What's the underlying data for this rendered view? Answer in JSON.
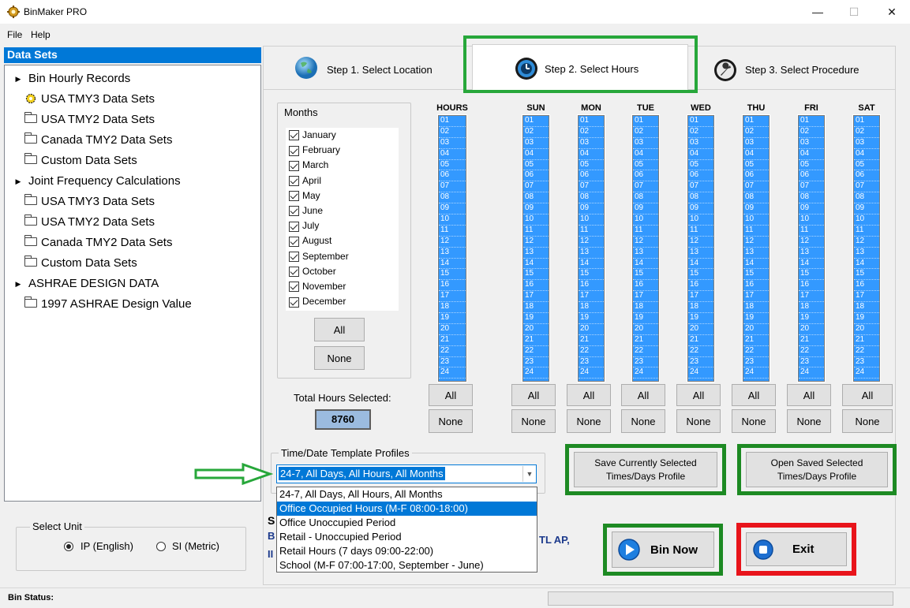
{
  "window": {
    "title": "BinMaker PRO",
    "minimize": "—",
    "maximize": "☐",
    "close": "✕"
  },
  "menu": {
    "file": "File",
    "help": "Help"
  },
  "data_sets": {
    "header": "Data Sets",
    "items": [
      {
        "label": "Bin Hourly Records",
        "icon": "expand-triangle"
      },
      {
        "label": "USA TMY3 Data Sets",
        "icon": "gear-icon"
      },
      {
        "label": "USA TMY2 Data Sets",
        "icon": "folder-icon"
      },
      {
        "label": "Canada TMY2 Data Sets",
        "icon": "folder-icon"
      },
      {
        "label": "Custom Data Sets",
        "icon": "folder-icon"
      },
      {
        "label": "Joint Frequency Calculations",
        "icon": "expand-triangle"
      },
      {
        "label": "USA TMY3 Data Sets",
        "icon": "folder-icon"
      },
      {
        "label": "USA TMY2 Data Sets",
        "icon": "folder-icon"
      },
      {
        "label": "Canada TMY2 Data Sets",
        "icon": "folder-icon"
      },
      {
        "label": "Custom Data Sets",
        "icon": "folder-icon"
      },
      {
        "label": "ASHRAE DESIGN DATA",
        "icon": "expand-triangle"
      },
      {
        "label": "1997 ASHRAE Design Value",
        "icon": "folder-icon"
      }
    ]
  },
  "unit": {
    "legend": "Select Unit",
    "ip": "IP (English)",
    "si": "SI (Metric)",
    "selected": "ip"
  },
  "tabs": {
    "step1": "Step 1.  Select Location",
    "step2": "Step 2.  Select Hours",
    "step3": "Step 3.  Select Procedure",
    "active": "step2"
  },
  "months": {
    "legend": "Months",
    "items": [
      "January",
      "February",
      "March",
      "April",
      "May",
      "June",
      "July",
      "August",
      "September",
      "October",
      "November",
      "December"
    ],
    "all_label": "All",
    "none_label": "None"
  },
  "hours": {
    "columns": [
      "HOURS",
      "SUN",
      "MON",
      "TUE",
      "WED",
      "THU",
      "FRI",
      "SAT"
    ],
    "values": [
      "01",
      "02",
      "03",
      "04",
      "05",
      "06",
      "07",
      "08",
      "09",
      "10",
      "11",
      "12",
      "13",
      "14",
      "15",
      "16",
      "17",
      "18",
      "19",
      "20",
      "21",
      "22",
      "23",
      "24"
    ],
    "all_label": "All",
    "none_label": "None"
  },
  "total": {
    "label": "Total Hours Selected:",
    "value": "8760"
  },
  "profiles": {
    "legend": "Time/Date Template Profiles",
    "selected": "24-7,  All Days, All Hours, All Months",
    "options": [
      "24-7,  All Days, All Hours, All Months",
      "Office Occupied Hours (M-F 08:00-18:00)",
      "Office Unoccupied Period",
      "Retail - Unoccupied Period",
      "Retail Hours (7 days  09:00-22:00)",
      "School (M-F 07:00-17:00, September - June)"
    ],
    "highlighted_index": 1
  },
  "buttons": {
    "save_profile": "Save Currently Selected Times/Days Profile",
    "open_profile": "Open Saved Selected Times/Days Profile",
    "bin_now": "Bin Now",
    "exit": "Exit"
  },
  "hidden_fragments": {
    "a": "S",
    "b": "B",
    "c": "II",
    "d": "TL AP,"
  },
  "status": {
    "label": "Bin Status:"
  },
  "colors": {
    "selection_blue": "#3399ff",
    "highlight_green": "#1d8a23",
    "exit_red": "#e8141b"
  }
}
